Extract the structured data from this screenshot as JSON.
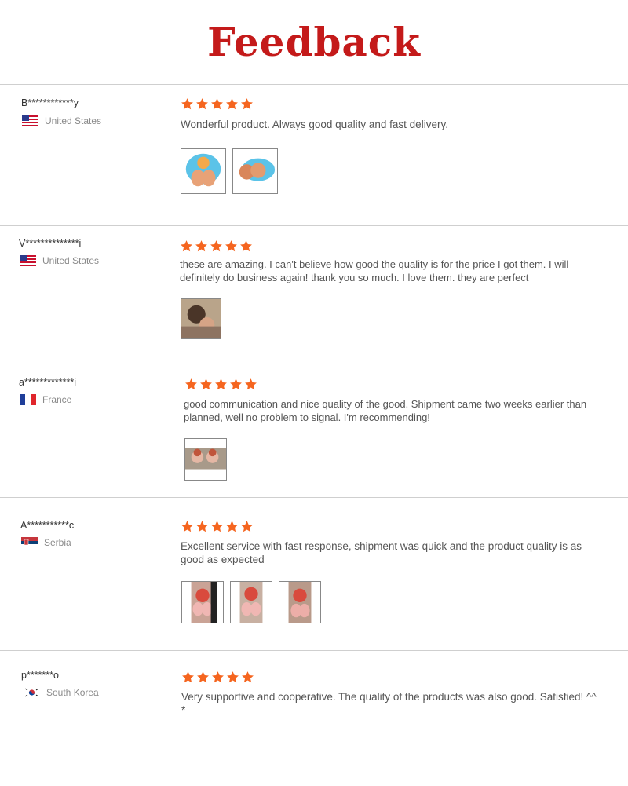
{
  "page": {
    "title": "Feedback"
  },
  "colors": {
    "title": "#c41a1a",
    "star": "#f5651f",
    "divider": "#cfcfcf"
  },
  "reviews": [
    {
      "user": "B************y",
      "country": "United States",
      "flag": "us-flag-icon",
      "rating": 5,
      "text": "Wonderful product. Always good quality and fast delivery.",
      "photo_count": 2
    },
    {
      "user": "V**************i",
      "country": "United States",
      "flag": "us-flag-icon",
      "rating": 5,
      "text": "these are amazing. I can't believe how good the quality is for the price I got them. I will definitely do business again! thank you so much. I love them. they are perfect",
      "photo_count": 1
    },
    {
      "user": "a*************i",
      "country": "France",
      "flag": "france-flag-icon",
      "rating": 5,
      "text": "good communication and nice quality of the good. Shipment came two weeks earlier than planned, well no problem to signal. I'm recommending!",
      "photo_count": 1
    },
    {
      "user": "A***********c",
      "country": "Serbia",
      "flag": "serbia-flag-icon",
      "rating": 5,
      "text": "Excellent service with fast response, shipment was quick and the product quality is as good as expected",
      "photo_count": 3
    },
    {
      "user": "p*******o",
      "country": "South Korea",
      "flag": "south-korea-flag-icon",
      "rating": 5,
      "text": "Very supportive and cooperative. The quality of the products was also good. Satisfied! ^^*",
      "photo_count": 0
    }
  ]
}
